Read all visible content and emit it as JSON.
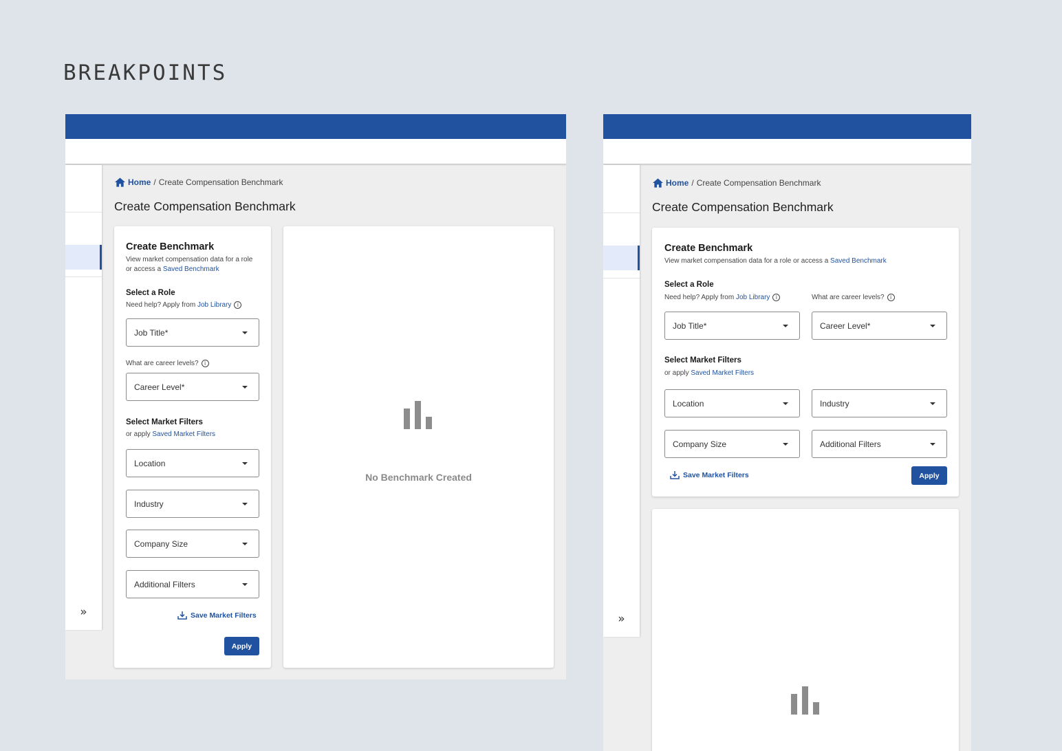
{
  "heading": "BREAKPOINTS",
  "breadcrumb": {
    "home": "Home",
    "separator": "/",
    "current": "Create Compensation Benchmark"
  },
  "page_title": "Create Compensation Benchmark",
  "sidebar": {
    "expand_glyph": "»"
  },
  "form": {
    "title": "Create Benchmark",
    "description_prefix_narrow_1": "View market compensation data for a role",
    "description_prefix_narrow_2": "or access a ",
    "description_prefix_wide": "View market compensation data for a role or access a ",
    "saved_benchmark_link": "Saved Benchmark",
    "role_heading": "Select a Role",
    "role_help_prefix": "Need help? Apply from ",
    "job_library_link": "Job Library",
    "career_help": "What are career levels?",
    "job_title": "Job Title*",
    "career_level": "Career Level*",
    "filters_heading": "Select Market Filters",
    "filters_help_prefix": "or apply ",
    "saved_filters_link": "Saved Market Filters",
    "location": "Location",
    "industry": "Industry",
    "company_size": "Company Size",
    "additional_filters": "Additional Filters",
    "save_filters": "Save Market Filters",
    "apply": "Apply"
  },
  "results": {
    "empty_text": "No Benchmark Created"
  },
  "icons": {
    "info": "info-icon",
    "home": "home-icon",
    "download": "download-icon",
    "chart": "bar-chart-icon",
    "caret": "caret-down-icon"
  },
  "colors": {
    "brand": "#21529f",
    "canvas": "#dfe3ea",
    "content": "#eeeeee"
  }
}
